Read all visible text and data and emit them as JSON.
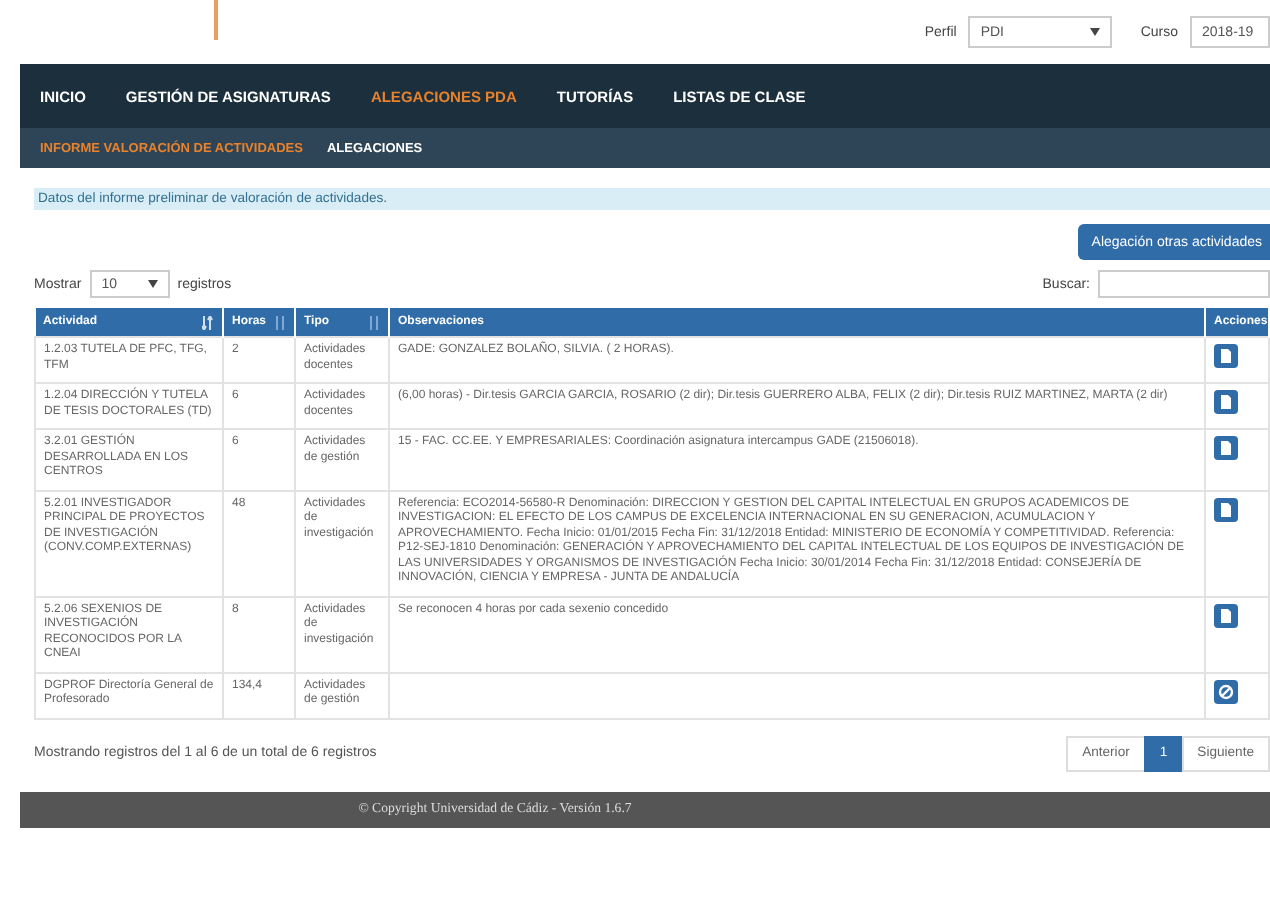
{
  "header": {
    "profile": {
      "label": "Perfil",
      "value": "PDI"
    },
    "course": {
      "label": "Curso",
      "value": "2018-19"
    }
  },
  "nav": [
    {
      "label": "INICIO",
      "selected": false
    },
    {
      "label": "GESTIÓN DE ASIGNATURAS",
      "selected": false
    },
    {
      "label": "ALEGACIONES PDA",
      "selected": true
    },
    {
      "label": "TUTORÍAS",
      "selected": false
    },
    {
      "label": "LISTAS DE CLASE",
      "selected": false
    }
  ],
  "subnav": [
    {
      "label": "INFORME VALORACIÓN DE ACTIVIDADES",
      "selected": true
    },
    {
      "label": "ALEGACIONES",
      "selected": false
    }
  ],
  "info": "Datos del informe preliminar de valoración de actividades.",
  "action_button": "Alegación otras actividades",
  "length": {
    "before": "Mostrar",
    "value": "10",
    "after": "registros"
  },
  "search": {
    "label": "Buscar:"
  },
  "table": {
    "columns": [
      {
        "label": "Actividad",
        "kind": "sorted"
      },
      {
        "label": "Horas",
        "kind": "sortable"
      },
      {
        "label": "Tipo",
        "kind": "sortable"
      },
      {
        "label": "Observaciones",
        "kind": "plain"
      },
      {
        "label": "Acciones",
        "kind": "plain"
      }
    ],
    "rows": [
      {
        "actividad": "1.2.03 TUTELA DE PFC, TFG, TFM",
        "horas": "2",
        "tipo": "Actividades docentes",
        "observaciones": "GADE: GONZALEZ BOLAÑO, SILVIA. ( 2 HORAS).",
        "kind": "document"
      },
      {
        "actividad": "1.2.04 DIRECCIÓN Y TUTELA DE TESIS DOCTORALES (TD)",
        "horas": "6",
        "tipo": "Actividades docentes",
        "observaciones": "(6,00 horas) - Dir.tesis GARCIA GARCIA, ROSARIO (2 dir); Dir.tesis GUERRERO ALBA, FELIX (2 dir); Dir.tesis RUIZ MARTINEZ, MARTA (2 dir)",
        "kind": "document"
      },
      {
        "actividad": "3.2.01 GESTIÓN DESARROLLADA EN LOS CENTROS",
        "horas": "6",
        "tipo": "Actividades de gestión",
        "observaciones": "15 - FAC. CC.EE. Y EMPRESARIALES: Coordinación asignatura intercampus GADE (21506018).",
        "kind": "document"
      },
      {
        "actividad": "5.2.01 INVESTIGADOR PRINCIPAL DE PROYECTOS DE INVESTIGACIÓN (CONV.COMP.EXTERNAS)",
        "horas": "48",
        "tipo": "Actividades de investigación",
        "observaciones": "Referencia: ECO2014-56580-R Denominación: DIRECCION Y GESTION DEL CAPITAL INTELECTUAL EN GRUPOS ACADEMICOS DE INVESTIGACION: EL EFECTO DE LOS CAMPUS DE EXCELENCIA INTERNACIONAL EN SU GENERACION, ACUMULACION Y APROVECHAMIENTO. Fecha Inicio: 01/01/2015 Fecha Fin: 31/12/2018 Entidad: MINISTERIO DE ECONOMÍA Y COMPETITIVIDAD. Referencia: P12-SEJ-1810 Denominación: GENERACIÓN Y APROVECHAMIENTO DEL CAPITAL INTELECTUAL DE LOS EQUIPOS DE INVESTIGACIÓN DE LAS UNIVERSIDADES Y ORGANISMOS DE INVESTIGACIÓN Fecha Inicio: 30/01/2014 Fecha Fin: 31/12/2018 Entidad: CONSEJERÍA DE INNOVACIÓN, CIENCIA Y EMPRESA - JUNTA DE ANDALUCÍA",
        "kind": "document"
      },
      {
        "actividad": "5.2.06 SEXENIOS DE INVESTIGACIÓN RECONOCIDOS POR LA CNEAI",
        "horas": "8",
        "tipo": "Actividades de investigación",
        "observaciones": "Se reconocen 4 horas por cada sexenio concedido",
        "kind": "document"
      },
      {
        "actividad": "DGPROF Directoría General de Profesorado",
        "horas": "134,4",
        "tipo": "Actividades de gestión",
        "kind": "blocked"
      }
    ]
  },
  "summary": "Mostrando registros del 1 al 6 de un total de 6 registros",
  "pagination": [
    {
      "label": "Anterior",
      "selected": false
    },
    {
      "label": "1",
      "selected": true
    },
    {
      "label": "Siguiente",
      "selected": false
    }
  ],
  "footer": "© Copyright Universidad de Cádiz - Versión 1.6.7"
}
